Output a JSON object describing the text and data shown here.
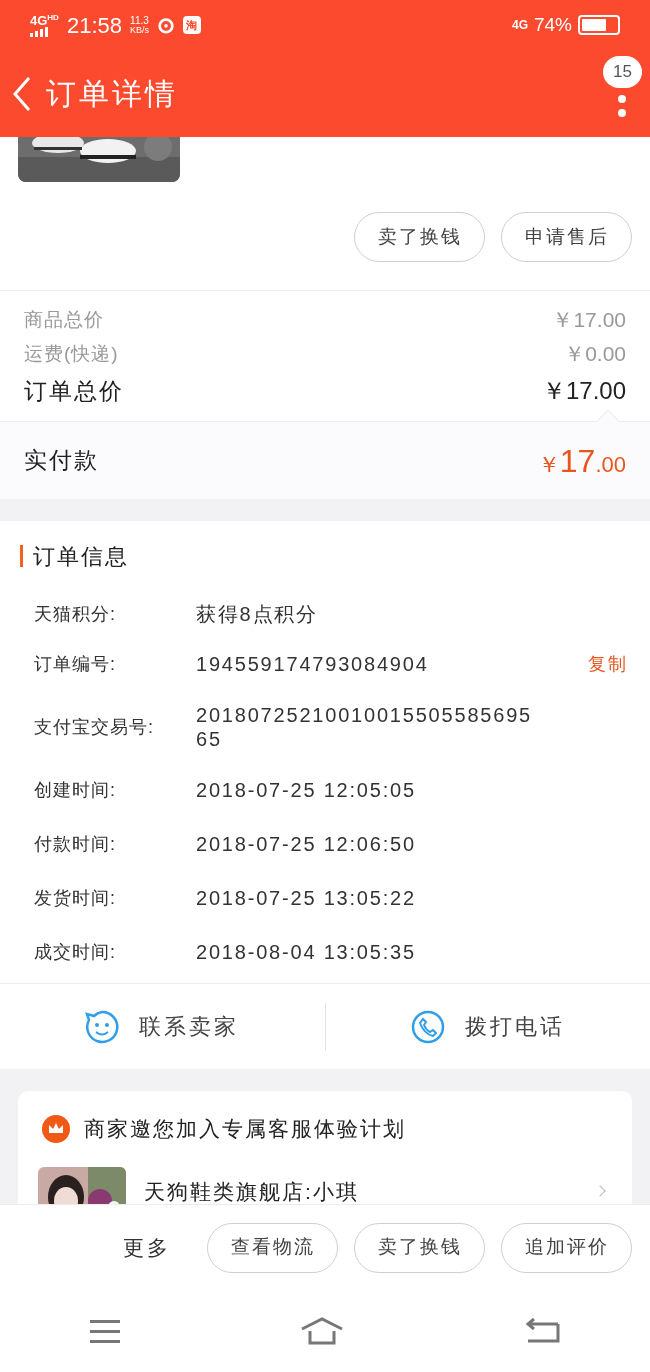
{
  "status_bar": {
    "network": "4G",
    "network_badge": "HD",
    "time": "21:58",
    "speed_value": "11.3",
    "speed_unit": "KB/s",
    "app_badge": "淘",
    "data_network": "4G",
    "battery": "74%"
  },
  "header": {
    "title": "订单详情",
    "badge": "15"
  },
  "item_actions": [
    "卖了换钱",
    "申请售后"
  ],
  "price_lines": [
    {
      "label": "商品总价",
      "value": "￥17.00",
      "kind": "minor"
    },
    {
      "label": "运费(快递)",
      "value": "￥0.00",
      "kind": "minor"
    },
    {
      "label": "订单总价",
      "value": "￥17.00",
      "kind": "total"
    }
  ],
  "paid": {
    "label": "实付款",
    "currency": "￥",
    "integer": "17",
    "decimal": ".00"
  },
  "order_info": {
    "title": "订单信息",
    "fields": [
      {
        "label": "天猫积分:",
        "value": "获得8点积分"
      },
      {
        "label": "订单编号:",
        "value": "194559174793084904",
        "action": "复制"
      },
      {
        "label": "支付宝交易号:",
        "value": "2018072521001001550558569565"
      },
      {
        "label": "创建时间:",
        "value": "2018-07-25 12:05:05"
      },
      {
        "label": "付款时间:",
        "value": "2018-07-25 12:06:50"
      },
      {
        "label": "发货时间:",
        "value": "2018-07-25 13:05:22"
      },
      {
        "label": "成交时间:",
        "value": "2018-08-04 13:05:35"
      }
    ]
  },
  "contact": [
    {
      "label": "联系卖家",
      "kind": "chat"
    },
    {
      "label": "拨打电话",
      "kind": "phone"
    }
  ],
  "service_card": {
    "title": "商家邀您加入专属客服体验计划",
    "staff": "天狗鞋类旗舰店:小琪"
  },
  "bottom_actions": {
    "more": "更多",
    "buttons": [
      "查看物流",
      "卖了换钱",
      "追加评价"
    ]
  }
}
